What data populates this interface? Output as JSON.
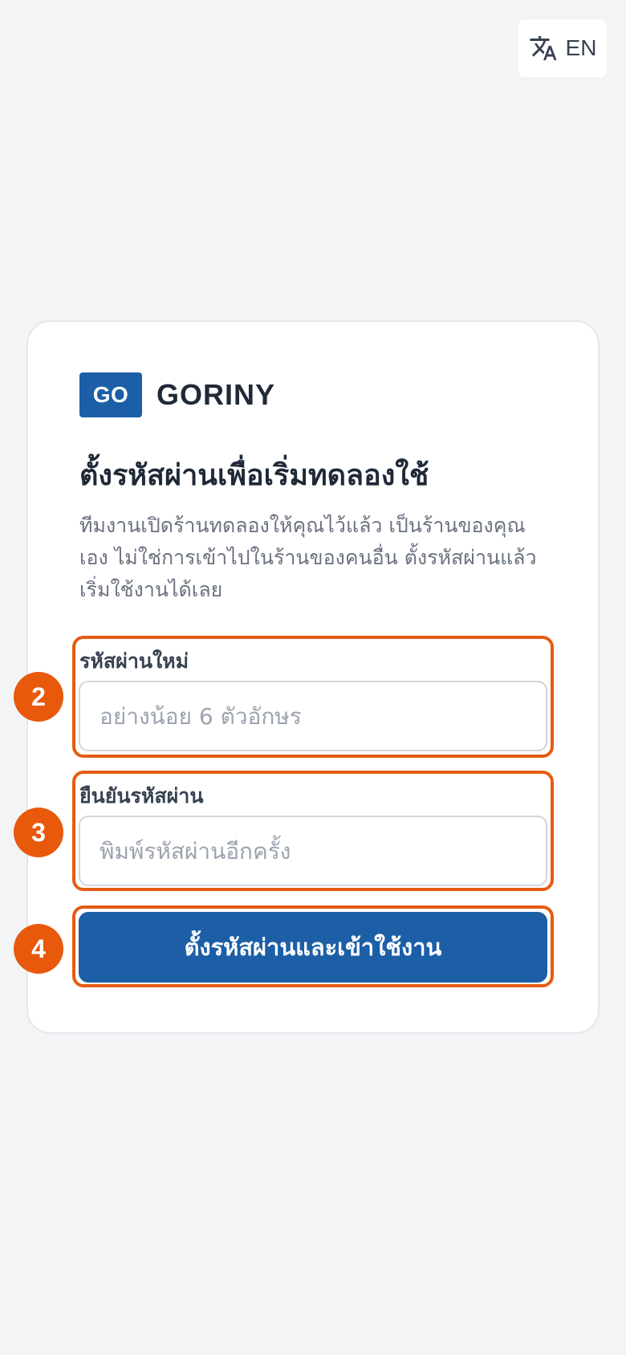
{
  "language_switcher": {
    "label": "EN",
    "icon": "translate-icon"
  },
  "brand": {
    "logo_text": "GO",
    "name": "GORINY",
    "color": "#1c5fa6"
  },
  "heading": {
    "title": "ตั้งรหัสผ่านเพื่อเริ่มทดลองใช้",
    "subtitle": "ทีมงานเปิดร้านทดลองให้คุณไว้แล้ว เป็นร้านของคุณเอง ไม่ใช่การเข้าไปในร้านของคนอื่น ตั้งรหัสผ่านแล้วเริ่มใช้งานได้เลย"
  },
  "form": {
    "new_password": {
      "label": "รหัสผ่านใหม่",
      "placeholder": "อย่างน้อย 6 ตัวอักษร",
      "value": ""
    },
    "confirm_password": {
      "label": "ยืนยันรหัสผ่าน",
      "placeholder": "พิมพ์รหัสผ่านอีกครั้ง",
      "value": ""
    },
    "submit_label": "ตั้งรหัสผ่านและเข้าใช้งาน"
  },
  "annotations": {
    "color": "#e55c12",
    "steps": [
      "2",
      "3",
      "4"
    ]
  }
}
